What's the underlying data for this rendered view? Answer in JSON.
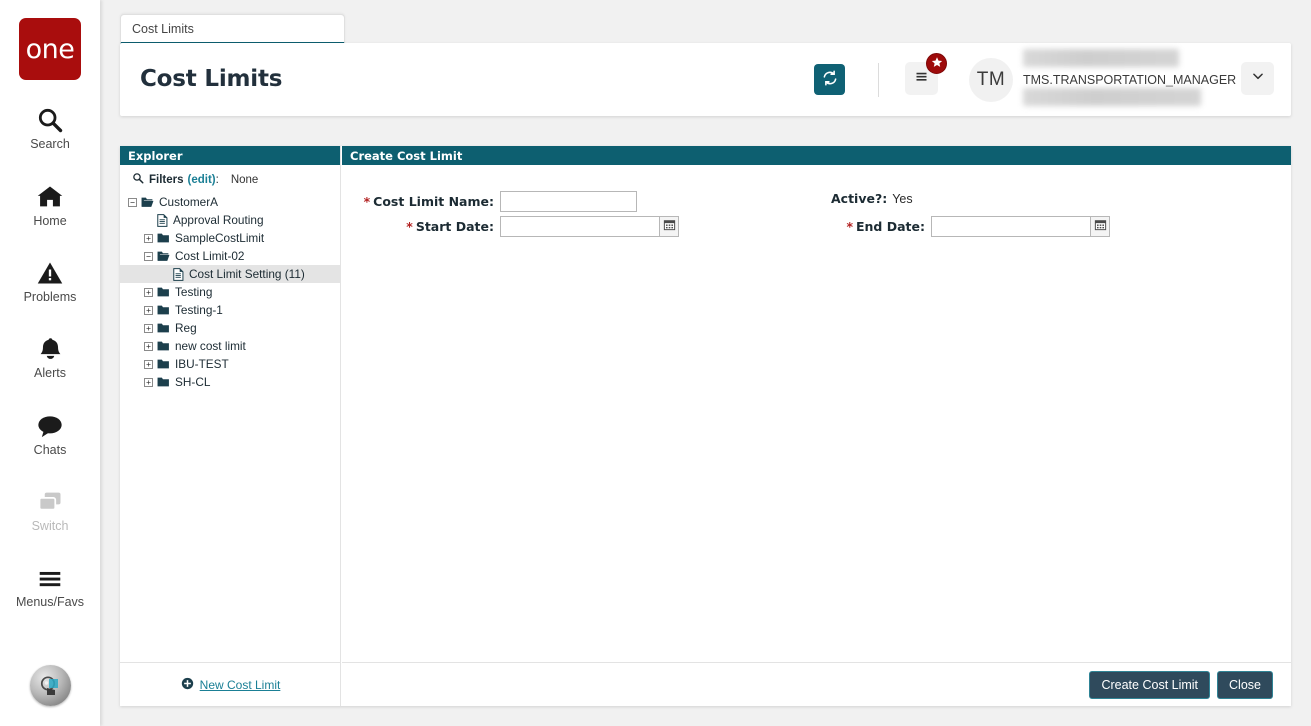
{
  "sidebar": {
    "logo_text": "one",
    "items": [
      {
        "label": "Search",
        "icon": "search-icon",
        "disabled": false
      },
      {
        "label": "Home",
        "icon": "home-icon",
        "disabled": false
      },
      {
        "label": "Problems",
        "icon": "warning-icon",
        "disabled": false
      },
      {
        "label": "Alerts",
        "icon": "bell-icon",
        "disabled": false
      },
      {
        "label": "Chats",
        "icon": "chat-icon",
        "disabled": false
      },
      {
        "label": "Switch",
        "icon": "switch-icon",
        "disabled": true
      },
      {
        "label": "Menus/Favs",
        "icon": "hamburger-icon",
        "disabled": false
      }
    ],
    "assistant_icon": "assistant-orb-icon"
  },
  "tabs": [
    {
      "label": "Cost Limits",
      "active": true
    }
  ],
  "header": {
    "title": "Cost Limits",
    "refresh_icon": "refresh-icon",
    "menu_icon": "hamburger-icon",
    "badge_icon": "star-icon",
    "avatar_initials": "TM",
    "username": "TMS.TRANSPORTATION_MANAGER",
    "chevron_icon": "chevron-down-icon"
  },
  "explorer": {
    "panel_title": "Explorer",
    "filters": {
      "icon": "search-icon",
      "label": "Filters",
      "edit_label": "(edit)",
      "separator": ":",
      "value": "None"
    },
    "tree": [
      {
        "label": "CustomerA",
        "depth": 0,
        "state": "expanded",
        "icon": "folder-open-icon",
        "selected": false
      },
      {
        "label": "Approval Routing",
        "depth": 1,
        "state": "leaf",
        "icon": "document-icon",
        "selected": false
      },
      {
        "label": "SampleCostLimit",
        "depth": 1,
        "state": "collapsed",
        "icon": "folder-icon",
        "selected": false
      },
      {
        "label": "Cost Limit-02",
        "depth": 1,
        "state": "expanded",
        "icon": "folder-open-icon",
        "selected": false
      },
      {
        "label": "Cost Limit Setting (11)",
        "depth": 2,
        "state": "leaf",
        "icon": "document-icon",
        "selected": true
      },
      {
        "label": "Testing",
        "depth": 1,
        "state": "collapsed",
        "icon": "folder-icon",
        "selected": false
      },
      {
        "label": "Testing-1",
        "depth": 1,
        "state": "collapsed",
        "icon": "folder-icon",
        "selected": false
      },
      {
        "label": "Reg",
        "depth": 1,
        "state": "collapsed",
        "icon": "folder-icon",
        "selected": false
      },
      {
        "label": "new cost limit",
        "depth": 1,
        "state": "collapsed",
        "icon": "folder-icon",
        "selected": false
      },
      {
        "label": "IBU-TEST",
        "depth": 1,
        "state": "collapsed",
        "icon": "folder-icon",
        "selected": false
      },
      {
        "label": "SH-CL",
        "depth": 1,
        "state": "collapsed",
        "icon": "folder-icon",
        "selected": false
      }
    ],
    "new_link": {
      "label": "New Cost Limit",
      "icon": "plus-circle-icon"
    }
  },
  "form": {
    "panel_title": "Create Cost Limit",
    "fields": {
      "cost_limit_name": {
        "label": "Cost Limit Name:",
        "required": true,
        "value": "",
        "placeholder": ""
      },
      "start_date": {
        "label": "Start Date:",
        "required": true,
        "value": "",
        "placeholder": "",
        "calendar_icon": "calendar-icon"
      },
      "active": {
        "label": "Active?:",
        "required": false,
        "value": "Yes"
      },
      "end_date": {
        "label": "End Date:",
        "required": true,
        "value": "",
        "placeholder": "",
        "calendar_icon": "calendar-icon"
      }
    },
    "buttons": {
      "primary": "Create Cost Limit",
      "secondary": "Close"
    }
  },
  "colors": {
    "brand_red": "#a90d0d",
    "teal": "#0d5f70",
    "link_teal": "#1a7f95",
    "button_navy": "#2f4a5c",
    "button_border": "#2f8496",
    "badge_red": "#9e0b0b",
    "required_red": "#b32222"
  }
}
